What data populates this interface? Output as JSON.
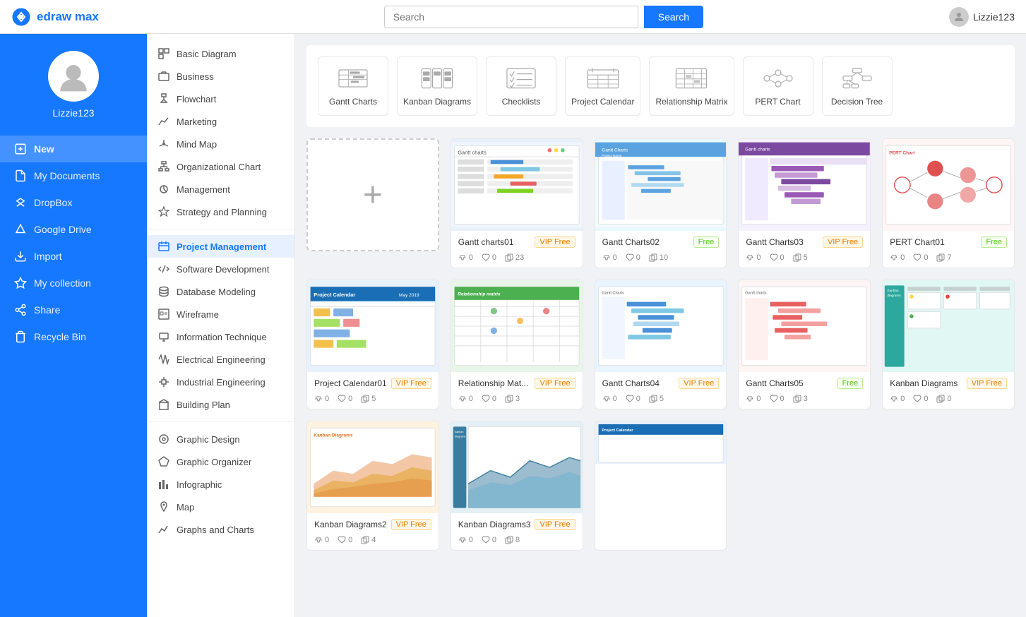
{
  "app": {
    "logo": "edraw max",
    "logo_icon": "◎"
  },
  "topbar": {
    "search_placeholder": "Search",
    "search_button": "Search",
    "username": "Lizzie123"
  },
  "sidebar_nav": [
    {
      "id": "new",
      "label": "New",
      "icon": "plus",
      "active": true
    },
    {
      "id": "my-documents",
      "label": "My Documents",
      "icon": "file"
    },
    {
      "id": "dropbox",
      "label": "DropBox",
      "icon": "dropbox"
    },
    {
      "id": "google-drive",
      "label": "Google Drive",
      "icon": "drive"
    },
    {
      "id": "import",
      "label": "Import",
      "icon": "import"
    },
    {
      "id": "my-collection",
      "label": "My collection",
      "icon": "star"
    },
    {
      "id": "share",
      "label": "Share",
      "icon": "share"
    },
    {
      "id": "recycle-bin",
      "label": "Recycle Bin",
      "icon": "trash"
    }
  ],
  "left_panel": [
    {
      "id": "basic-diagram",
      "label": "Basic Diagram",
      "active": false
    },
    {
      "id": "business",
      "label": "Business",
      "active": false
    },
    {
      "id": "flowchart",
      "label": "Flowchart",
      "active": false
    },
    {
      "id": "marketing",
      "label": "Marketing",
      "active": false
    },
    {
      "id": "mind-map",
      "label": "Mind Map",
      "active": false
    },
    {
      "id": "org-chart",
      "label": "Organizational Chart",
      "active": false
    },
    {
      "id": "management",
      "label": "Management",
      "active": false
    },
    {
      "id": "strategy",
      "label": "Strategy and Planning",
      "active": false
    },
    {
      "divider": true
    },
    {
      "id": "project-mgmt",
      "label": "Project Management",
      "active": true
    },
    {
      "id": "software-dev",
      "label": "Software Development",
      "active": false
    },
    {
      "id": "database-modeling",
      "label": "Database Modeling",
      "active": false
    },
    {
      "id": "wireframe",
      "label": "Wireframe",
      "active": false
    },
    {
      "id": "info-tech",
      "label": "Information Technique",
      "active": false
    },
    {
      "id": "electrical-eng",
      "label": "Electrical Engineering",
      "active": false
    },
    {
      "id": "industrial-eng",
      "label": "Industrial Engineering",
      "active": false
    },
    {
      "id": "building-plan",
      "label": "Building Plan",
      "active": false
    },
    {
      "divider": true
    },
    {
      "id": "graphic-design",
      "label": "Graphic Design",
      "active": false
    },
    {
      "id": "graphic-organizer",
      "label": "Graphic Organizer",
      "active": false
    },
    {
      "id": "infographic",
      "label": "Infographic",
      "active": false
    },
    {
      "id": "map",
      "label": "Map",
      "active": false
    },
    {
      "id": "graphs-charts",
      "label": "Graphs and Charts",
      "active": false
    }
  ],
  "categories": [
    {
      "id": "gantt",
      "label": "Gantt Charts"
    },
    {
      "id": "kanban",
      "label": "Kanban Diagrams"
    },
    {
      "id": "checklists",
      "label": "Checklists"
    },
    {
      "id": "project-calendar",
      "label": "Project Calendar"
    },
    {
      "id": "relationship-matrix",
      "label": "Relationship Matrix"
    },
    {
      "id": "pert-chart",
      "label": "PERT Chart"
    },
    {
      "id": "decision-tree",
      "label": "Decision Tree"
    }
  ],
  "templates": [
    {
      "id": "add-new",
      "type": "add"
    },
    {
      "id": "gantt01",
      "name": "Gantt charts01",
      "badge": "VIP Free",
      "badge_type": "vip",
      "likes": 0,
      "hearts": 0,
      "copies": 23,
      "color": "#4a7fc1"
    },
    {
      "id": "gantt02",
      "name": "Gantt Charts02",
      "badge": "Free",
      "badge_type": "free",
      "likes": 0,
      "hearts": 0,
      "copies": 10,
      "color": "#5ba3e0"
    },
    {
      "id": "gantt03",
      "name": "Gantt Charts03",
      "badge": "VIP Free",
      "badge_type": "vip",
      "likes": 0,
      "hearts": 0,
      "copies": 5,
      "color": "#7b4aa0"
    },
    {
      "id": "pert01",
      "name": "PERT Chart01",
      "badge": "Free",
      "badge_type": "free",
      "likes": 0,
      "hearts": 0,
      "copies": 7,
      "color": "#e05050"
    },
    {
      "id": "project-cal01",
      "name": "Project Calendar01",
      "badge": "VIP Free",
      "badge_type": "vip",
      "likes": 0,
      "hearts": 0,
      "copies": 5,
      "color": "#1a6eb5"
    },
    {
      "id": "rel-mat01",
      "name": "Relationship Mat...",
      "badge": "VIP Free",
      "badge_type": "vip",
      "likes": 0,
      "hearts": 0,
      "copies": 3,
      "color": "#4caf50"
    },
    {
      "id": "gantt04",
      "name": "Gantt Charts04",
      "badge": "VIP Free",
      "badge_type": "vip",
      "likes": 0,
      "hearts": 0,
      "copies": 5,
      "color": "#5ba3e0"
    },
    {
      "id": "gantt05",
      "name": "Gantt Charts05",
      "badge": "Free",
      "badge_type": "free",
      "likes": 0,
      "hearts": 0,
      "copies": 3,
      "color": "#e05050"
    },
    {
      "id": "kanban01",
      "name": "Kanban Diagrams",
      "badge": "VIP Free",
      "badge_type": "vip",
      "likes": 0,
      "hearts": 0,
      "copies": 0,
      "color": "#2da89e"
    },
    {
      "id": "kanban02",
      "name": "Kanban Diagrams2",
      "badge": "VIP Free",
      "badge_type": "vip",
      "likes": 0,
      "hearts": 0,
      "copies": 4,
      "color": "#e07020"
    },
    {
      "id": "kanban03",
      "name": "Kanban Diagrams3",
      "badge": "VIP Free",
      "badge_type": "vip",
      "likes": 0,
      "hearts": 0,
      "copies": 8,
      "color": "#3a7ca0"
    }
  ]
}
